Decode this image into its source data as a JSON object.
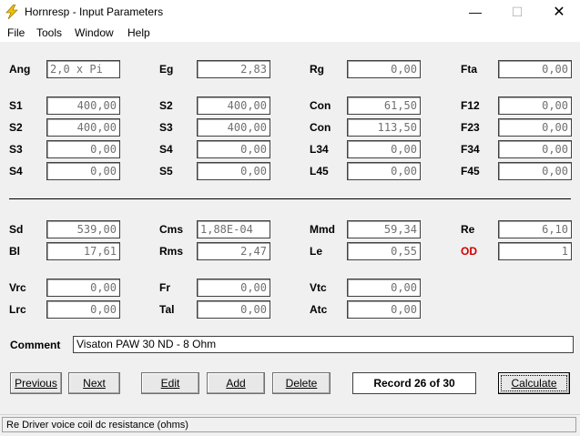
{
  "window": {
    "title": "Hornresp - Input Parameters",
    "minimize": "—",
    "maximize": "☐",
    "close": "✕"
  },
  "menu": [
    "File",
    "Tools",
    "Window",
    "Help"
  ],
  "rows": {
    "r1": [
      {
        "label": "Ang",
        "value": "2,0 x Pi"
      },
      {
        "label": "Eg",
        "value": "2,83"
      },
      {
        "label": "Rg",
        "value": "0,00"
      },
      {
        "label": "Fta",
        "value": "0,00"
      }
    ],
    "r2": [
      {
        "label": "S1",
        "value": "400,00"
      },
      {
        "label": "S2",
        "value": "400,00"
      },
      {
        "label": "Con",
        "value": "61,50"
      },
      {
        "label": "F12",
        "value": "0,00"
      }
    ],
    "r3": [
      {
        "label": "S2",
        "value": "400,00"
      },
      {
        "label": "S3",
        "value": "400,00"
      },
      {
        "label": "Con",
        "value": "113,50"
      },
      {
        "label": "F23",
        "value": "0,00"
      }
    ],
    "r4": [
      {
        "label": "S3",
        "value": "0,00"
      },
      {
        "label": "S4",
        "value": "0,00"
      },
      {
        "label": "L34",
        "value": "0,00"
      },
      {
        "label": "F34",
        "value": "0,00"
      }
    ],
    "r5": [
      {
        "label": "S4",
        "value": "0,00"
      },
      {
        "label": "S5",
        "value": "0,00"
      },
      {
        "label": "L45",
        "value": "0,00"
      },
      {
        "label": "F45",
        "value": "0,00"
      }
    ],
    "r6": [
      {
        "label": "Sd",
        "value": "539,00"
      },
      {
        "label": "Cms",
        "value": "1,88E-04"
      },
      {
        "label": "Mmd",
        "value": "59,34"
      },
      {
        "label": "Re",
        "value": "6,10"
      }
    ],
    "r7": [
      {
        "label": "Bl",
        "value": "17,61"
      },
      {
        "label": "Rms",
        "value": "2,47"
      },
      {
        "label": "Le",
        "value": "0,55"
      },
      {
        "label": "OD",
        "value": "1"
      }
    ],
    "r8": [
      {
        "label": "Vrc",
        "value": "0,00"
      },
      {
        "label": "Fr",
        "value": "0,00"
      },
      {
        "label": "Vtc",
        "value": "0,00"
      }
    ],
    "r9": [
      {
        "label": "Lrc",
        "value": "0,00"
      },
      {
        "label": "Tal",
        "value": "0,00"
      },
      {
        "label": "Atc",
        "value": "0,00"
      }
    ]
  },
  "comment": {
    "label": "Comment",
    "value": "Visaton PAW 30 ND - 8 Ohm"
  },
  "buttons": {
    "previous": "Previous",
    "next": "Next",
    "edit": "Edit",
    "add": "Add",
    "delete": "Delete",
    "calculate": "Calculate"
  },
  "record": "Record 26 of 30",
  "status": "Re   Driver voice coil dc resistance  (ohms)",
  "colors": {
    "od_label": "#d00000",
    "field_text": "#707070"
  }
}
